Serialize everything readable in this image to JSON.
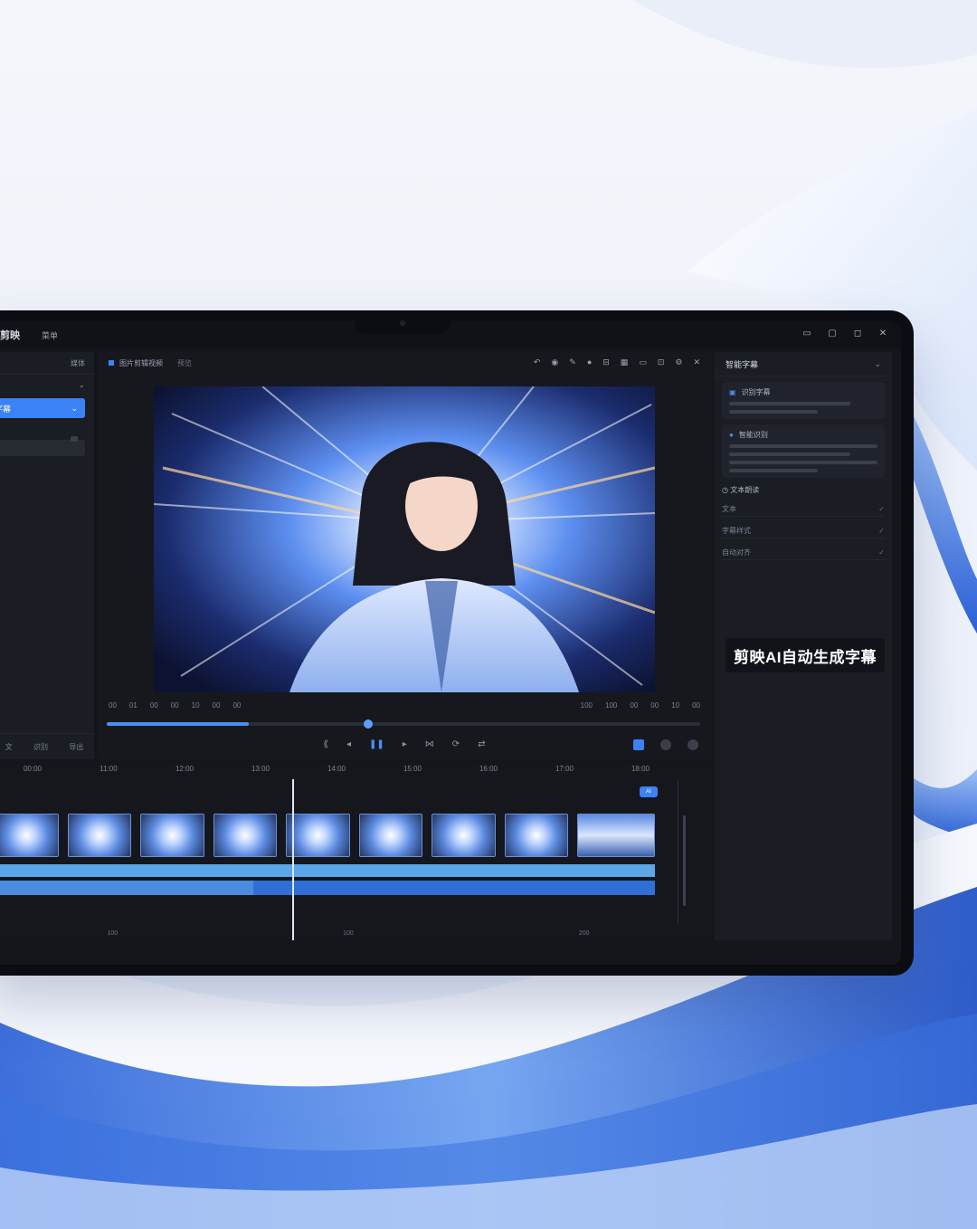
{
  "app": {
    "title": "剪映",
    "menu_label": "菜单"
  },
  "left_panel": {
    "header": "媒体",
    "active_item": "字幕",
    "footer_items": [
      "文",
      "识别",
      "导出"
    ]
  },
  "center_panel": {
    "project_name": "图片剪辑视频",
    "sub_label": "预览",
    "readout_left": [
      "00",
      "01",
      "00",
      "00",
      "10",
      "00",
      "00"
    ],
    "readout_right": [
      "100",
      "100",
      "00",
      "00",
      "10",
      "00"
    ],
    "progress_fraction": 0.24,
    "scrub_fraction": 0.44
  },
  "right_panel": {
    "header": "智能字幕",
    "card1_title": "识别字幕",
    "card2_title": "智能识别",
    "section_label": "文本朗读",
    "list_items": [
      "文本",
      "字幕样式",
      "自动对齐"
    ],
    "caption_badge": "剪映AI自动生成字幕"
  },
  "timeline": {
    "ruler": [
      "00:00",
      "11:00",
      "12:00",
      "13:00",
      "14:00",
      "15:00",
      "16:00",
      "17:00",
      "18:00"
    ],
    "marker": "AI",
    "footer": [
      "100",
      "100",
      "200"
    ]
  },
  "icons": {
    "minimize": "minimize-icon",
    "restore": "restore-icon",
    "maximize": "maximize-icon",
    "close": "close-icon"
  },
  "colors": {
    "accent": "#3b82f6",
    "panel": "#1a1d24",
    "caption_text": "#ffffff"
  }
}
